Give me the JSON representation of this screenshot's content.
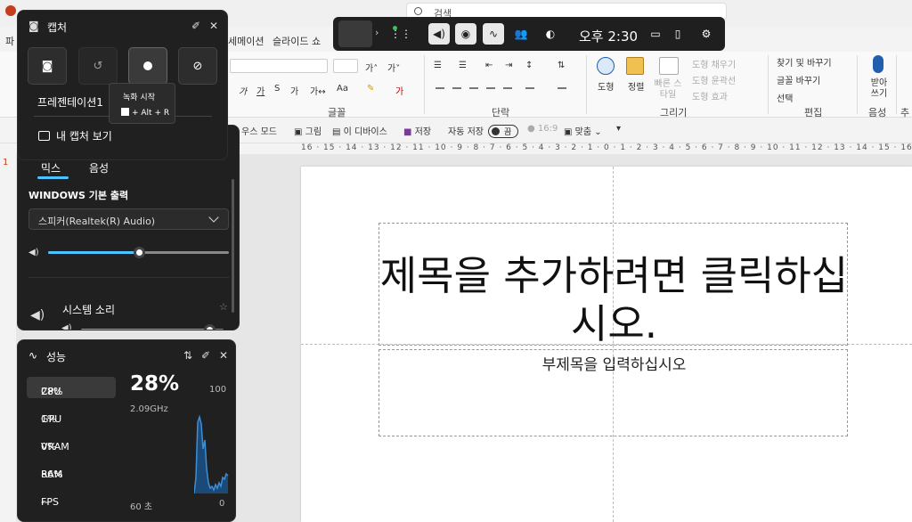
{
  "ppt": {
    "search_placeholder": "검색",
    "tabs": [
      "파",
      "세메이션",
      "슬라이드 쇼"
    ],
    "ribbon_groups": {
      "font": "글꼴",
      "paragraph": "단락",
      "drawing": "그리기",
      "editing": "편집",
      "voice": "음성",
      "addin": "추가"
    },
    "drawing_buttons": {
      "shape": "도형",
      "arrange": "정렬",
      "quick_styles": "빠른 스타일"
    },
    "shape_format": {
      "fill": "도형 채우기",
      "outline": "도형 윤곽선",
      "effects": "도형 효과"
    },
    "editing_buttons": {
      "find_replace": "찾기 및 바꾸기",
      "replace_font": "글꼴 바꾸기",
      "select": "선택"
    },
    "dictate": "받아쓰기",
    "qat": {
      "mode": "우스 모드",
      "picture": "그림",
      "from_device": "이 디바이스",
      "save": "저장",
      "autosave": "자동 저장",
      "autosave_state": "끔",
      "aspect": "16:9",
      "fit": "맞춤"
    },
    "ruler_text": "16 · 15 · 14 · 13 · 12 · 11 · 10 · 9 · 8 · 7 · 6 · 5 · 4 · 3 · 2 · 1 · 0 · 1 · 2 · 3 · 4 · 5 · 6 · 7 · 8 · 9 · 10 · 11 · 12 · 13 · 14 · 15 · 16",
    "slide_number": "1",
    "slide": {
      "title_placeholder": "제목을 추가하려면 클릭하십시오.",
      "subtitle_placeholder": "부제목을 입력하십시오"
    }
  },
  "gamebar": {
    "time": "오후 2:30",
    "buttons": [
      "widget-menu-icon",
      "volume-icon",
      "camera-icon",
      "performance-icon",
      "people-icon",
      "edge-icon",
      "battery-icon",
      "mouse-icon",
      "gear-icon"
    ]
  },
  "capture": {
    "title": "캡처",
    "app_name": "프레젠테이션1",
    "view_captures": "내 캡처 보기",
    "tooltip_title": "녹화 시작",
    "tooltip_shortcut": "+ Alt + R"
  },
  "audio": {
    "tabs": [
      "믹스",
      "음성"
    ],
    "output_heading": "WINDOWS 기본 출력",
    "device": "스피커(Realtek(R) Audio)",
    "master_volume": 0.5,
    "system_sounds_label": "시스템 소리",
    "system_volume": 0.9
  },
  "performance": {
    "title": "성능",
    "metrics": [
      {
        "label": "CPU",
        "value": "28%"
      },
      {
        "label": "GPU",
        "value": "1%"
      },
      {
        "label": "VRAM",
        "value": "0%"
      },
      {
        "label": "RAM",
        "value": "86%"
      },
      {
        "label": "FPS",
        "value": "--"
      }
    ],
    "big_value": "28%",
    "frequency": "2.09GHz",
    "axis_max": "100",
    "axis_min": "0",
    "time_window": "60 초",
    "accent": "#3a8fd8"
  }
}
